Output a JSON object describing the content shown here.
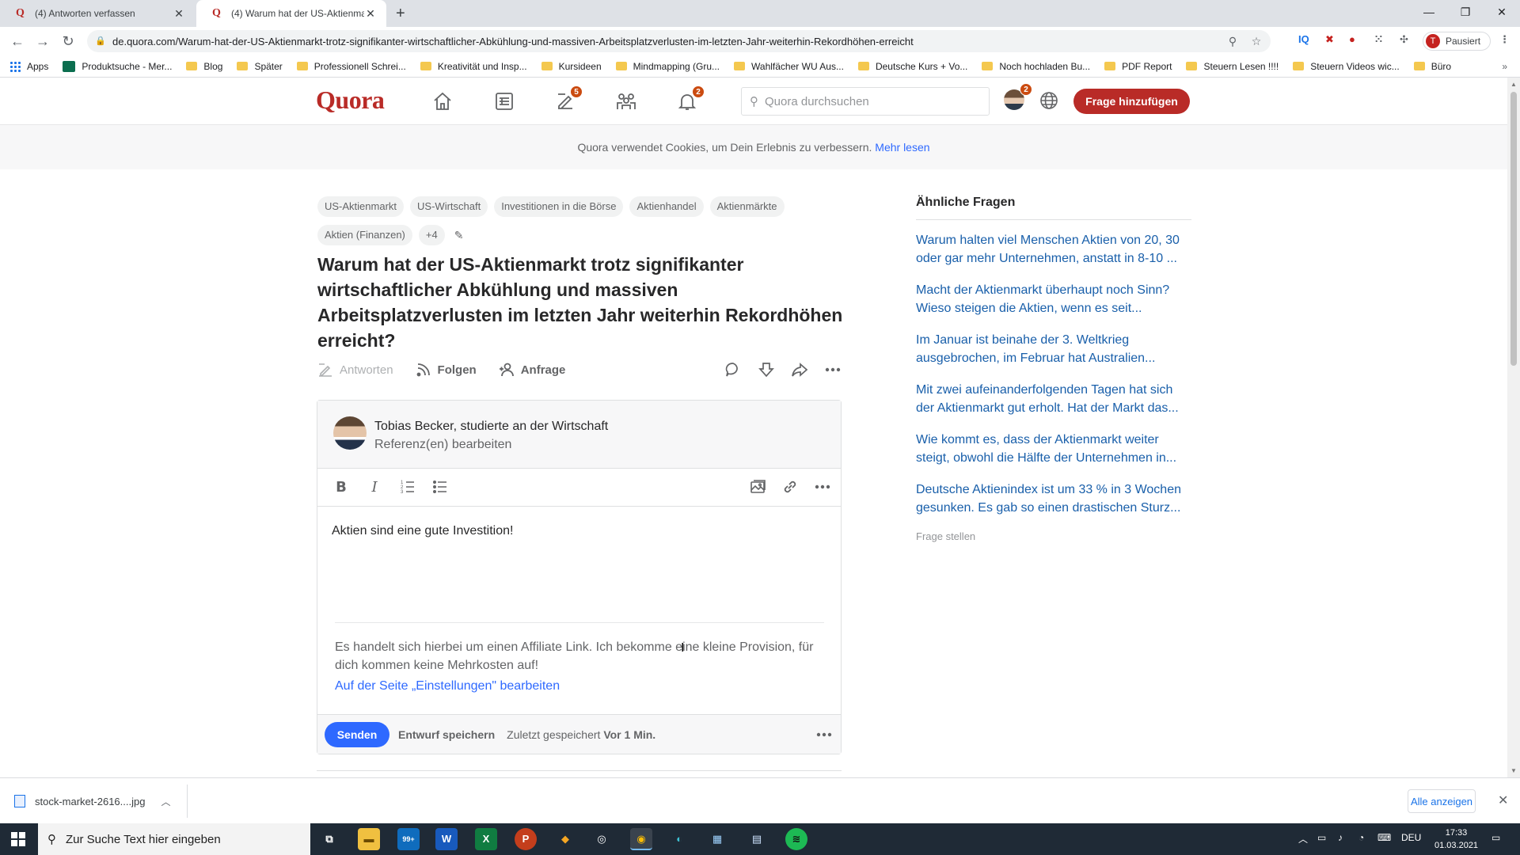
{
  "browser": {
    "tabs": [
      {
        "title": "(4) Antworten verfassen",
        "active": false
      },
      {
        "title": "(4) Warum hat der US-Aktienmar",
        "active": true
      }
    ],
    "url": "de.quora.com/Warum-hat-der-US-Aktienmarkt-trotz-signifikanter-wirtschaftlicher-Abkühlung-und-massiven-Arbeitsplatzverlusten-im-letzten-Jahr-weiterhin-Rekordhöhen-erreicht",
    "profile_initial": "T",
    "profile_label": "Pausiert",
    "bookmarks": [
      {
        "label": "Apps",
        "icon": "apps-grid-icon"
      },
      {
        "label": "Produktsuche - Mer...",
        "icon": "site-logo-icon"
      },
      {
        "label": "Blog",
        "icon": "folder-icon"
      },
      {
        "label": "Später",
        "icon": "folder-icon"
      },
      {
        "label": "Professionell Schrei...",
        "icon": "folder-icon"
      },
      {
        "label": "Kreativität und Insp...",
        "icon": "folder-icon"
      },
      {
        "label": "Kursideen",
        "icon": "folder-icon"
      },
      {
        "label": "Mindmapping (Gru...",
        "icon": "folder-icon"
      },
      {
        "label": "Wahlfächer WU Aus...",
        "icon": "folder-icon"
      },
      {
        "label": "Deutsche Kurs + Vo...",
        "icon": "folder-icon"
      },
      {
        "label": "Noch hochladen Bu...",
        "icon": "folder-icon"
      },
      {
        "label": "PDF Report",
        "icon": "folder-icon"
      },
      {
        "label": "Steuern Lesen !!!!",
        "icon": "folder-icon"
      },
      {
        "label": "Steuern Videos wic...",
        "icon": "folder-icon"
      },
      {
        "label": "Büro",
        "icon": "folder-icon"
      }
    ],
    "bookmarks_more": "»"
  },
  "quora": {
    "logo": "Quora",
    "badges": {
      "answer": "5",
      "notifications": "2",
      "avatar": "2"
    },
    "search_placeholder": "Quora durchsuchen",
    "add_question": "Frage hinzufügen",
    "brand_color": "#b92b27",
    "link_color": "#2e69ff"
  },
  "cookie": {
    "text": "Quora verwendet Cookies, um Dein Erlebnis zu verbessern.",
    "link": "Mehr lesen"
  },
  "question": {
    "topics": [
      "US-Aktienmarkt",
      "US-Wirtschaft",
      "Investitionen in die Börse",
      "Aktienhandel",
      "Aktienmärkte",
      "Aktien (Finanzen)",
      "+4"
    ],
    "title": "Warum hat der US-Aktienmarkt trotz signifikanter wirtschaftlicher Abkühlung und massiven Arbeitsplatzverlusten im letzten Jahr weiterhin Rekordhöhen erreicht?",
    "actions": {
      "answer": "Antworten",
      "follow": "Folgen",
      "request": "Anfrage"
    }
  },
  "editor": {
    "author": "Tobias Becker, studierte an der Wirtschaft",
    "credentials": "Referenz(en) bearbeiten",
    "body": "Aktien sind eine gute Investition!",
    "disclaimer": "Es handelt sich hierbei um einen Affiliate Link. Ich bekomme eine kleine Provision, für dich kommen keine Mehrkosten auf!",
    "settings_link": "Auf der Seite „Einstellungen\" bearbeiten",
    "send": "Senden",
    "save_draft": "Entwurf speichern",
    "last_saved_prefix": "Zuletzt gespeichert",
    "last_saved_time": "Vor 1 Min."
  },
  "related": {
    "title": "Ähnliche Fragen",
    "items": [
      "Warum halten viel Menschen Aktien von 20, 30 oder gar mehr Unternehmen, anstatt in 8-10 ...",
      "Macht der Aktienmarkt überhaupt noch Sinn? Wieso steigen die Aktien, wenn es seit...",
      "Im Januar ist beinahe der 3. Weltkrieg ausgebrochen, im Februar hat Australien...",
      "Mit zwei aufeinanderfolgenden Tagen hat sich der Aktienmarkt gut erholt. Hat der Markt das...",
      "Wie kommt es, dass der Aktienmarkt weiter steigt, obwohl die Hälfte der Unternehmen in...",
      "Deutsche Aktienindex ist um 33 % in 3 Wochen gesunken. Es gab so einen drastischen Sturz..."
    ],
    "ask": "Frage stellen"
  },
  "downloads": {
    "file": "stock-market-2616....jpg",
    "show_all": "Alle anzeigen"
  },
  "taskbar": {
    "search_placeholder": "Zur Suche Text hier eingeben",
    "mail_badge": "99+",
    "lang": "DEU",
    "time": "17:33",
    "date": "01.03.2021"
  }
}
